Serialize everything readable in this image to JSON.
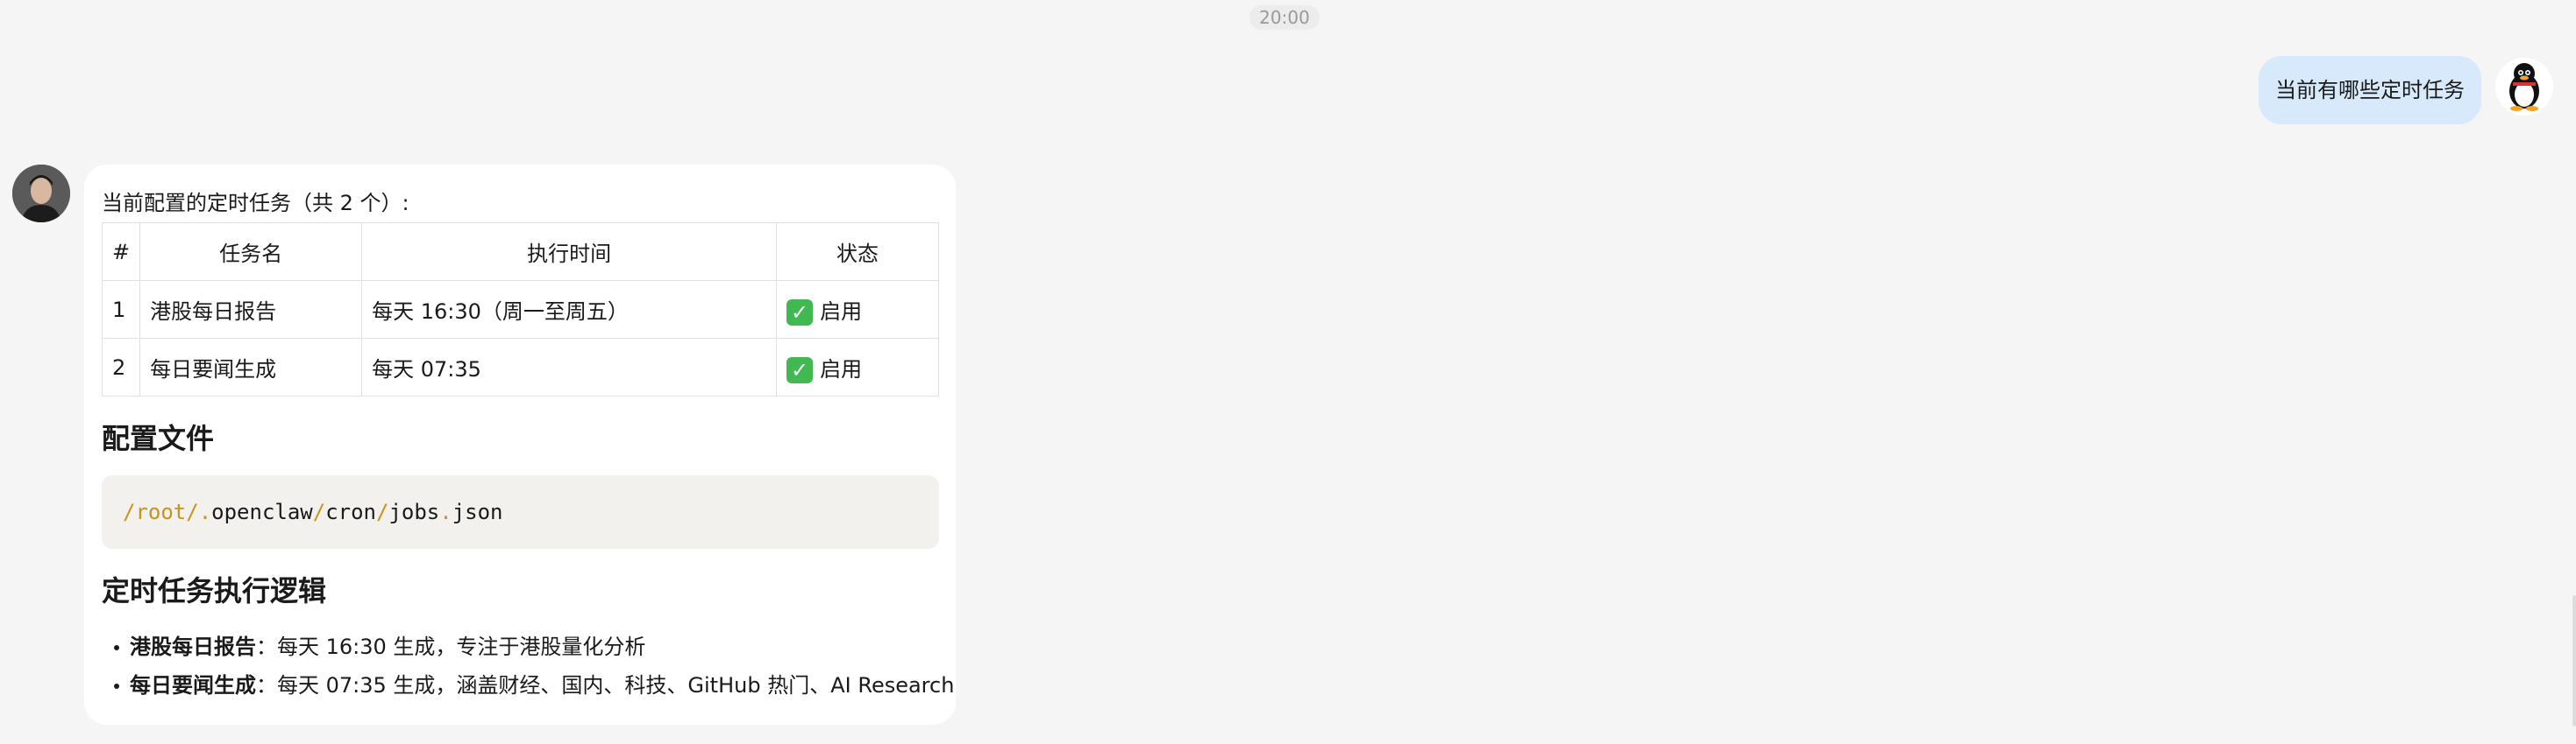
{
  "timestamp": "20:00",
  "user_message": {
    "text": "当前有哪些定时任务",
    "avatar_icon": "penguin-icon"
  },
  "bot_message": {
    "avatar_icon": "person-avatar",
    "intro": "当前配置的定时任务（共 2 个）:",
    "table": {
      "headers": [
        "#",
        "任务名",
        "执行时间",
        "状态"
      ],
      "rows": [
        {
          "index": "1",
          "name": "港股每日报告",
          "time": "每天 16:30（周一至周五）",
          "status": "启用"
        },
        {
          "index": "2",
          "name": "每日要闻生成",
          "time": "每天 07:35",
          "status": "启用"
        }
      ]
    },
    "config_heading": "配置文件",
    "config_path": {
      "p1": "/root/",
      "p2": ".",
      "p3": "openclaw",
      "p4": "/",
      "p5": "cron",
      "p6": "/",
      "p7": "jobs",
      "p8": ".",
      "p9": "json"
    },
    "logic_heading": "定时任务执行逻辑",
    "logic_items": [
      {
        "title": "港股每日报告",
        "desc": "：每天 16:30 生成，专注于港股量化分析"
      },
      {
        "title": "每日要闻生成",
        "desc": "：每天 07:35 生成，涵盖财经、国内、科技、GitHub 热门、AI Research"
      }
    ]
  },
  "colors": {
    "user_bubble": "#d7e9fb",
    "bot_bubble": "#ffffff",
    "code_accent": "#c8941a",
    "status_check": "#3fb950"
  }
}
